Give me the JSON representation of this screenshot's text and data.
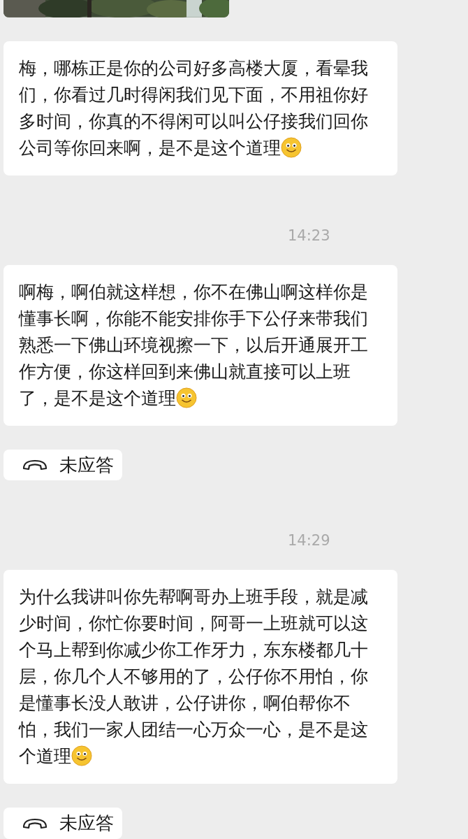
{
  "messages": [
    {
      "kind": "picture"
    },
    {
      "kind": "text",
      "text": "梅，哪栋正是你的公司好多高楼大厦，看晕我们，你看过几时得闲我们见下面，不用祖你好多时间，你真的不得闲可以叫公仔接我们回你公司等你回来啊，是不是这个道理",
      "emoji": true
    },
    {
      "kind": "time",
      "text": "14:23"
    },
    {
      "kind": "text",
      "text": "啊梅，啊伯就这样想，你不在佛山啊这样你是懂事长啊，你能不能安排你手下公仔来带我们熟悉一下佛山环境视擦一下，以后开通展开工作方便，你这样回到来佛山就直接可以上班了，是不是这个道理",
      "emoji": true
    },
    {
      "kind": "call",
      "text": "未应答"
    },
    {
      "kind": "time",
      "text": "14:29"
    },
    {
      "kind": "text",
      "text": "为什么我讲叫你先帮啊哥办上班手段，就是减少时间，你忙你要时间，阿哥一上班就可以这个马上帮到你减少你工作牙力，东东楼都几十层，你几个人不够用的了，公仔你不用怕，你是懂事长没人敢讲，公仔讲你，啊伯帮你不怕，我们一家人团结一心万众一心，是不是这个道理",
      "emoji": true
    },
    {
      "kind": "call",
      "text": "未应答"
    }
  ]
}
